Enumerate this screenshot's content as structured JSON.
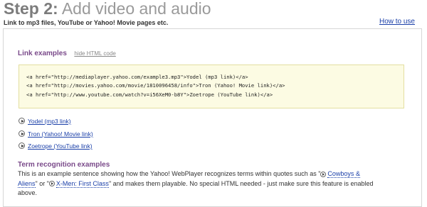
{
  "header": {
    "step_label": "Step 2:",
    "title": "Add video and audio",
    "subtitle": "Link to mp3 files, YouTube or Yahoo! Movie pages etc.",
    "how_to_use": "How to use"
  },
  "link_examples": {
    "heading": "Link examples",
    "hide_html_label": "hide HTML code",
    "code_lines": [
      "<a href=\"http://mediaplayer.yahoo.com/example3.mp3\">Yodel (mp3 link)</a>",
      "<a href=\"http://movies.yahoo.com/movie/1810096458/info\">Tron (Yahoo! Movie link)</a>",
      "<a href=\"http://www.youtube.com/watch?v=i56XeM0-b8Y\">Zoetrope (YouTube link)</a>"
    ],
    "links": [
      {
        "label": "Yodel (mp3 link)",
        "icon": "play-icon"
      },
      {
        "label": "Tron (Yahoo! Movie link)",
        "icon": "play-icon"
      },
      {
        "label": "Zoetrope (YouTube link)",
        "icon": "play-icon"
      }
    ]
  },
  "term_recognition": {
    "heading": "Term recognition examples",
    "text_1": "This is an example sentence showing how the Yahoo! WebPlayer recognizes terms within quotes such as \"",
    "term_1": "Cowboys & Aliens",
    "text_2": "\" or \"",
    "term_2": "X-Men: First Class",
    "text_3": "\" and makes them playable. No special HTML needed - just make sure this feature is enabled above."
  }
}
